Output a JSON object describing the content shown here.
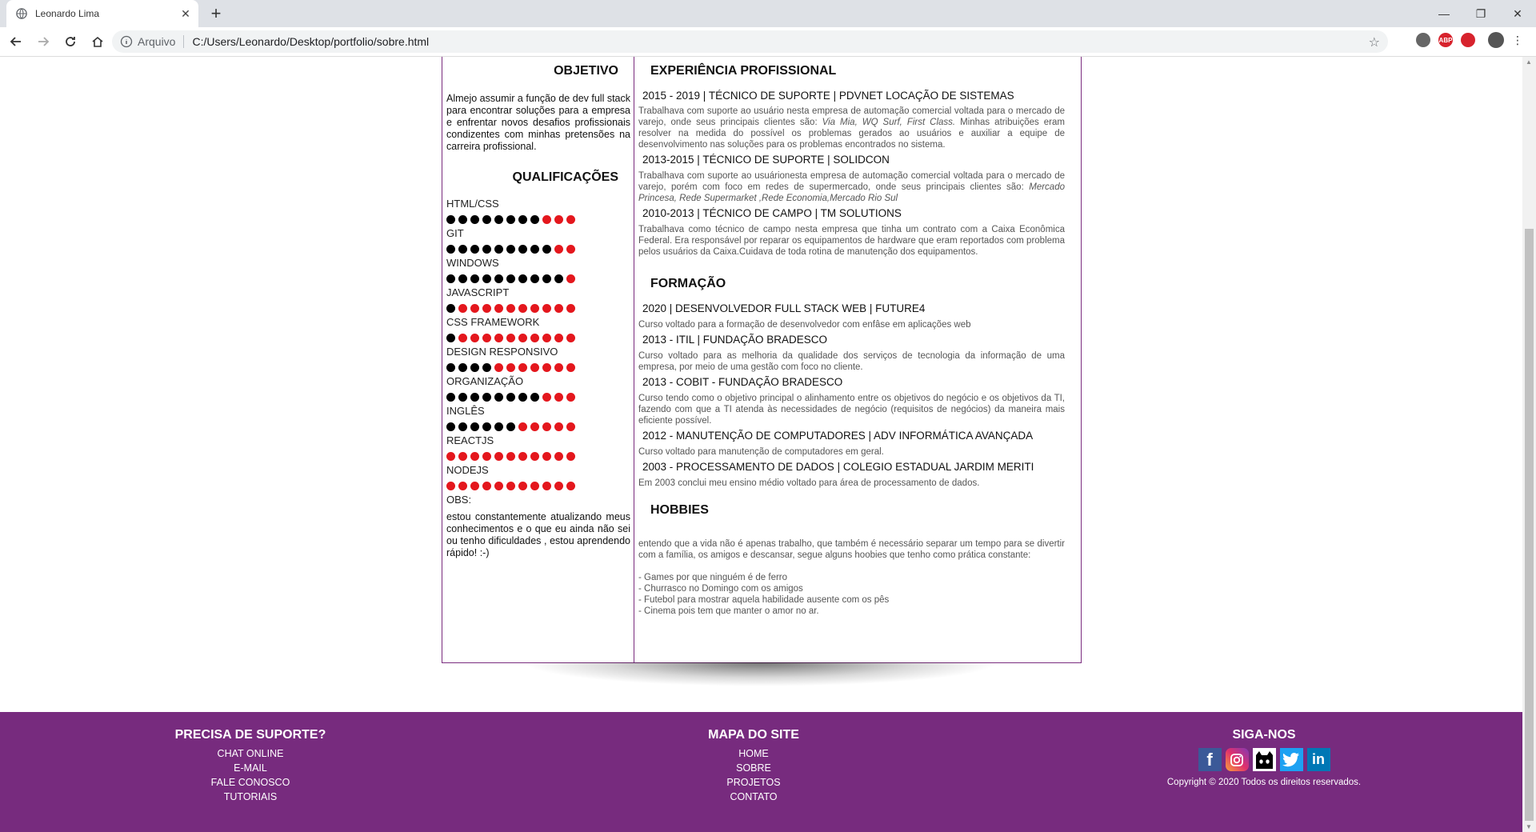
{
  "browser": {
    "tab_title": "Leonardo Lima",
    "new_tab": "+",
    "url_scheme": "Arquivo",
    "url": "C:/Users/Leonardo/Desktop/portfolio/sobre.html",
    "extensions": [
      "ABP"
    ]
  },
  "left": {
    "objective_heading": "OBJETIVO",
    "objective_text": "Almejo assumir a função de dev full stack para encontrar soluções para a empresa e enfrentar novos desafios profissionais condizentes com minhas pretensões na carreira profissional.",
    "qualifications_heading": "QUALIFICAÇÕES",
    "skills": [
      {
        "name": "HTML/CSS",
        "level": 8
      },
      {
        "name": "GIT",
        "level": 9
      },
      {
        "name": "WINDOWS",
        "level": 10
      },
      {
        "name": "JAVASCRIPT",
        "level": 1
      },
      {
        "name": "CSS FRAMEWORK",
        "level": 1
      },
      {
        "name": "DESIGN RESPONSIVO",
        "level": 4
      },
      {
        "name": "ORGANIZAÇÃO",
        "level": 8
      },
      {
        "name": "INGLÊS",
        "level": 6
      },
      {
        "name": "REACTJS",
        "level": 0
      },
      {
        "name": "NODEJS",
        "level": 0
      }
    ],
    "skill_max": 11,
    "obs_label": "OBS:",
    "obs_text": "estou constantemente atualizando meus conhecimentos e o que eu ainda não sei ou tenho dificuldades , estou aprendendo rápido! :-)"
  },
  "right": {
    "experience_heading": "EXPERIÊNCIA PROFISSIONAL",
    "exp1_title": "2015 - 2019 | TÉCNICO DE SUPORTE | PDVNET LOCAÇÃO DE SISTEMAS",
    "exp1_text_a": "Trabalhava com suporte ao usuário nesta empresa de automação comercial voltada para o mercado de varejo, onde seus principais clientes são: ",
    "exp1_text_italic": "Via Mia, WQ Surf, First Class.",
    "exp1_text_b": " Minhas atribuições eram resolver na medida do possível os problemas gerados ao usuários e auxiliar a equipe de desenvolvimento nas soluções para os problemas encontrados no sistema.",
    "exp2_title": "2013-2015 | TÉCNICO DE SUPORTE | SOLIDCON",
    "exp2_text_a": "Trabalhava com suporte ao usuárionesta empresa de automação comercial voltada para o mercado de varejo, porém com foco em redes de supermercado, onde seus principais clientes são: ",
    "exp2_text_italic": "Mercado Princesa, Rede Supermarket ,Rede Economia,Mercado Rio Sul",
    "exp3_title": "2010-2013 | TÉCNICO DE CAMPO | TM SOLUTIONS",
    "exp3_text": "Trabalhava como técnico de campo nesta empresa que tinha um contrato com a Caixa Econômica Federal. Era responsável por reparar os equipamentos de hardware que eram reportados com problema pelos usuários da Caixa.Cuidava de toda rotina de manutenção dos equipamentos.",
    "education_heading": "FORMAÇÃO",
    "edu1_title": "2020 | DESENVOLVEDOR FULL STACK WEB | FUTURE4",
    "edu1_text": "Curso voltado para a formação de desenvolvedor com enfâse em aplicações web",
    "edu2_title": "2013 - ITIL | FUNDAÇÃO BRADESCO",
    "edu2_text": "Curso voltado para as melhoria da qualidade dos serviços de tecnologia da informação de uma empresa, por meio de uma gestão com foco no cliente.",
    "edu3_title": "2013 - COBIT - FUNDAÇÃO BRADESCO",
    "edu3_text": "Curso tendo como o objetivo principal o alinhamento entre os objetivos do negócio e os objetivos da TI, fazendo com que a TI atenda às necessidades de negócio (requisitos de negócios) da maneira mais eficiente possível.",
    "edu4_title": "2012 - MANUTENÇÃO DE COMPUTADORES | ADV INFORMÁTICA AVANÇADA",
    "edu4_text": "Curso voltado para manutenção de computadores em geral.",
    "edu5_title": "2003 - PROCESSAMENTO DE DADOS | COLEGIO ESTADUAL JARDIM MERITI",
    "edu5_text": "Em 2003 conclui meu ensino médio voltado para área de processamento de dados.",
    "hobbies_heading": "HOBBIES",
    "hobbies_intro": "entendo que a vida não é apenas trabalho, que também é necessário separar um tempo para se divertir com a família, os amigos e descansar, segue alguns hoobies que tenho como prática constante:",
    "hobby1": "- Games por que ninguém é de ferro",
    "hobby2": "- Churrasco no Domingo com os amigos",
    "hobby3": "- Futebol para mostrar aquela habilidade ausente com os pês",
    "hobby4": "- Cinema pois tem que manter o amor no ar."
  },
  "footer": {
    "support_heading": "PRECISA DE SUPORTE?",
    "support_links": [
      "CHAT ONLINE",
      "E-MAIL",
      "FALE CONOSCO",
      "TUTORIAIS"
    ],
    "sitemap_heading": "MAPA DO SITE",
    "sitemap_links": [
      "HOME",
      "SOBRE",
      "PROJETOS",
      "CONTATO"
    ],
    "follow_heading": "SIGA-NOS",
    "social": [
      "facebook",
      "instagram",
      "github",
      "twitter",
      "linkedin"
    ],
    "social_linkedin_text": "in",
    "copyright": "Copyright © 2020 Todos os direitos reservados."
  },
  "colors": {
    "accent": "#772b7e",
    "dot_filled": "#000000",
    "dot_empty": "#e4171d"
  }
}
